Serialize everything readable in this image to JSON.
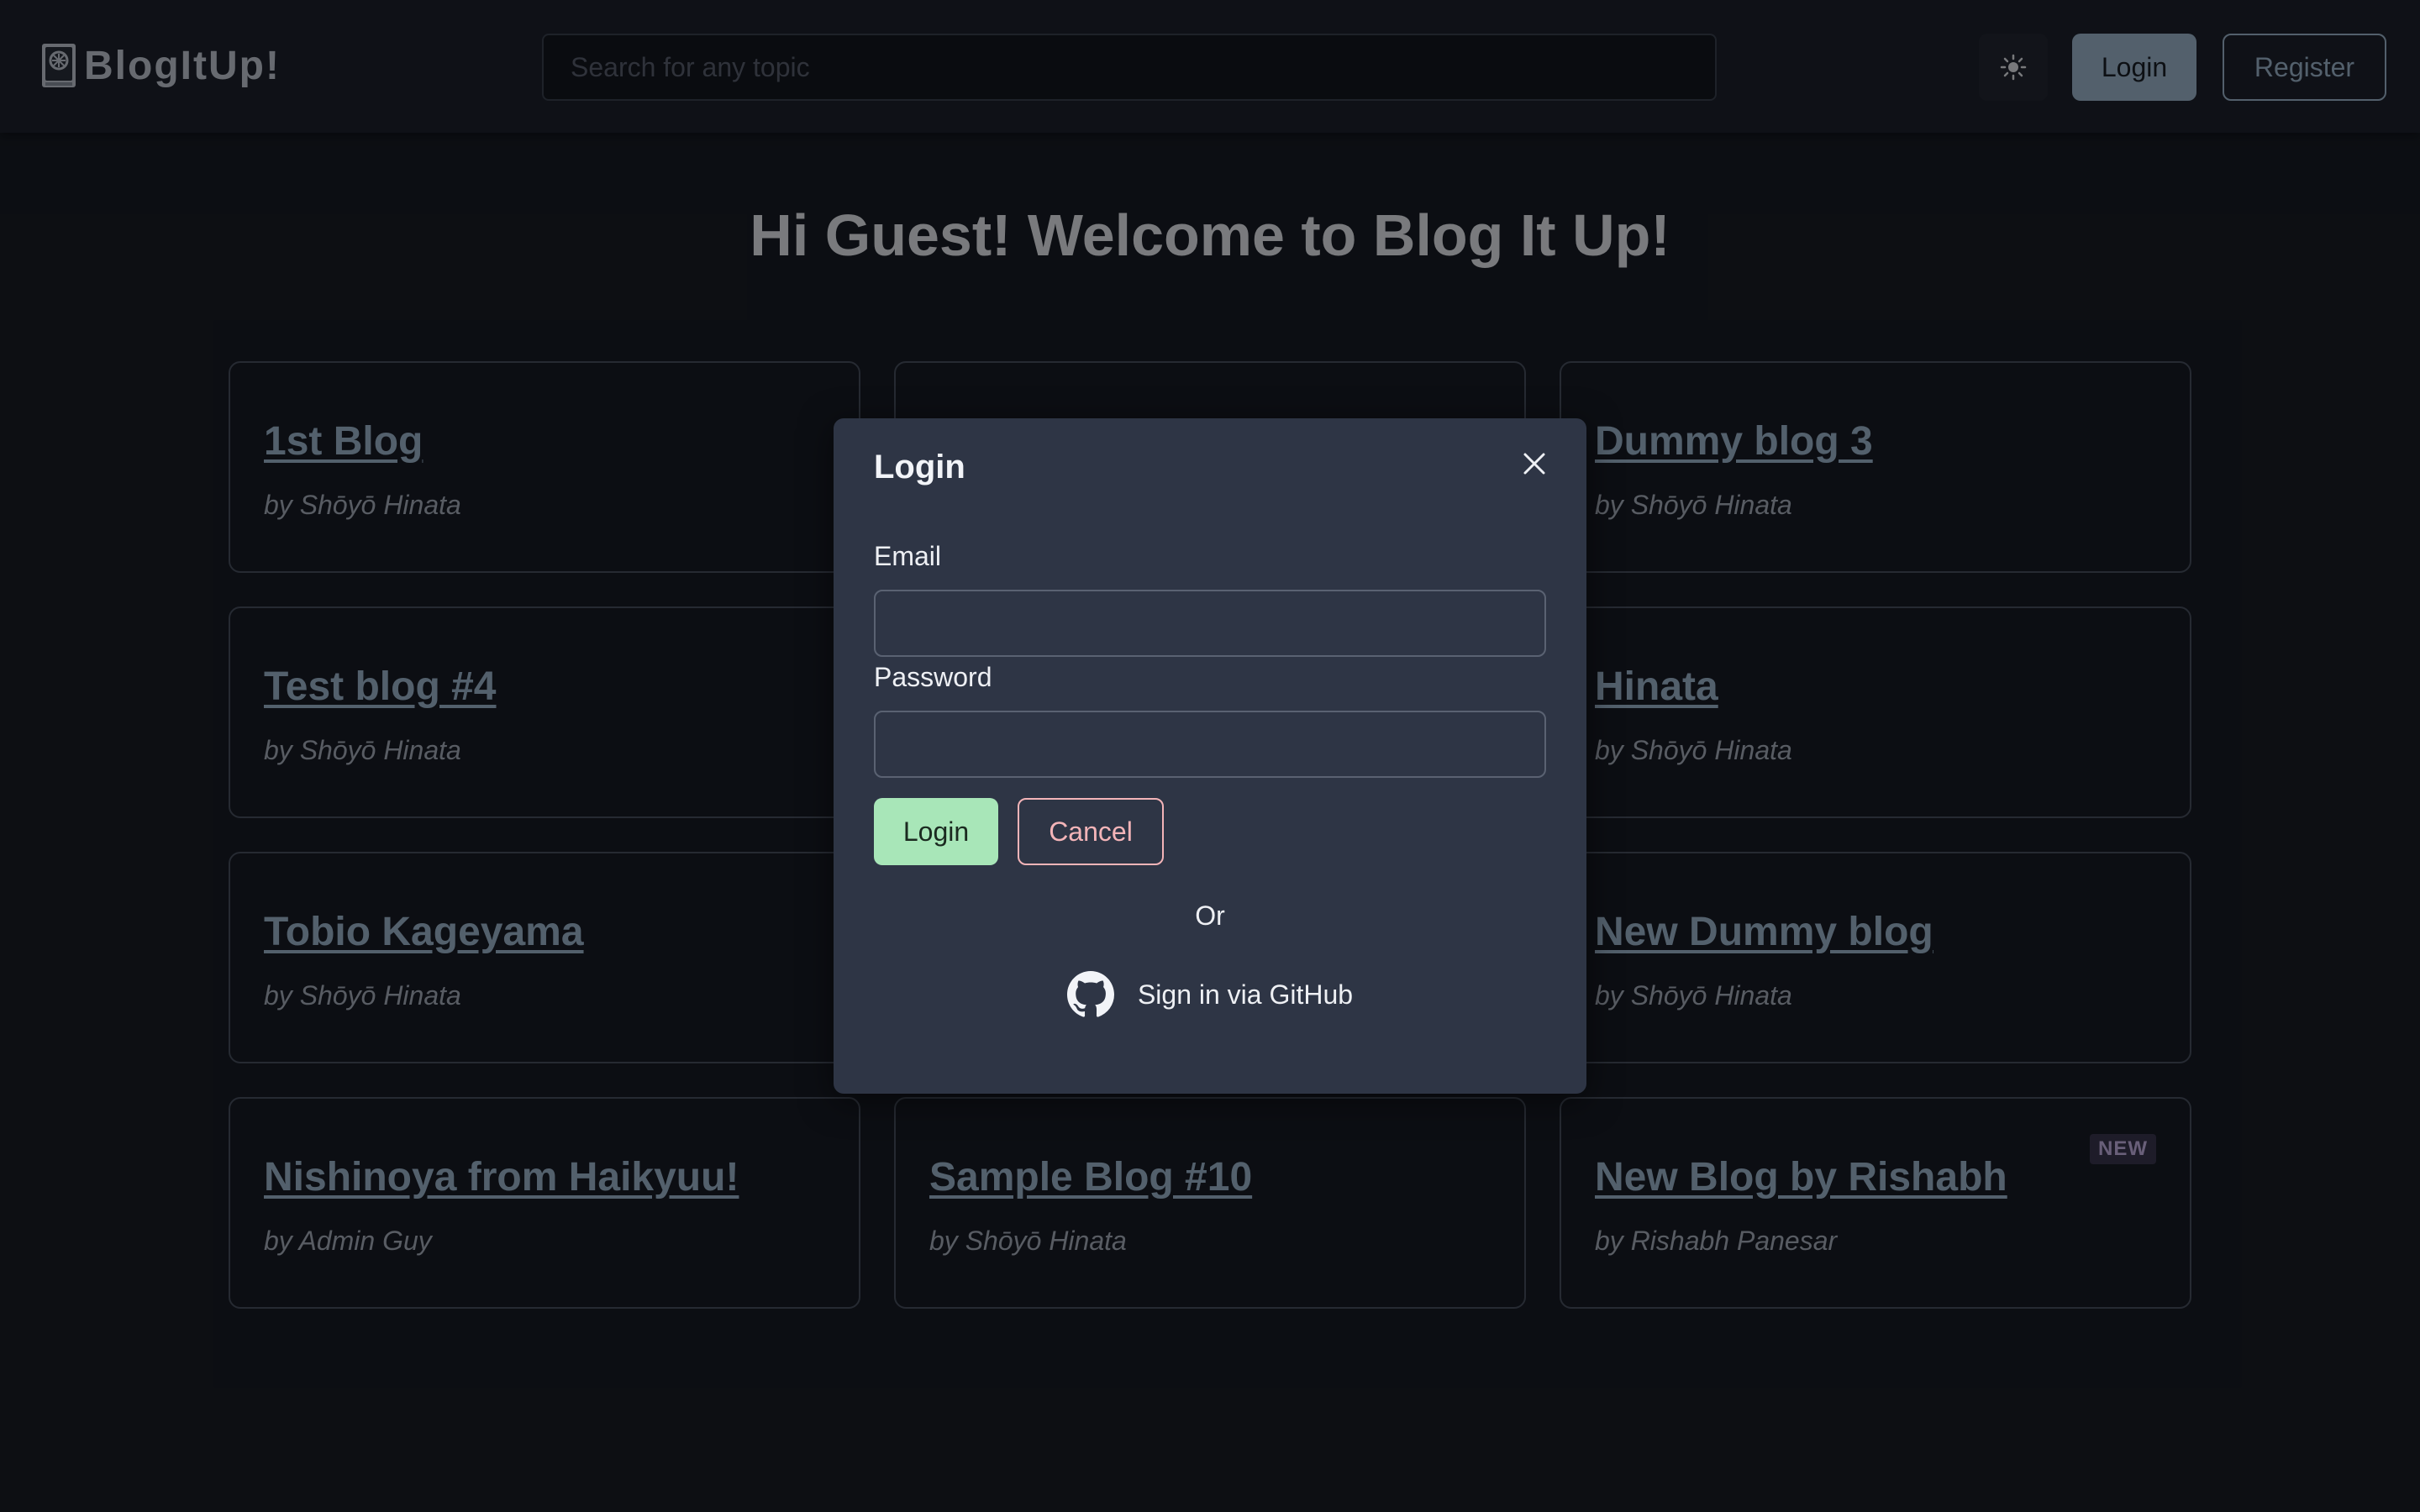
{
  "header": {
    "logo_text": "BlogItUp!",
    "search_placeholder": "Search for any topic",
    "theme_icon": "sun-icon",
    "login_label": "Login",
    "register_label": "Register"
  },
  "main": {
    "welcome": "Hi Guest! Welcome to Blog It Up!",
    "cards": [
      {
        "title": "1st Blog",
        "author": "by Shōyō Hinata"
      },
      {
        "title": "",
        "author": ""
      },
      {
        "title": "Dummy blog 3",
        "author": "by Shōyō Hinata"
      },
      {
        "title": "Test blog #4",
        "author": "by Shōyō Hinata"
      },
      {
        "title": "",
        "author": ""
      },
      {
        "title": "Hinata",
        "author": "by Shōyō Hinata"
      },
      {
        "title": "Tobio Kageyama",
        "author": "by Shōyō Hinata"
      },
      {
        "title": "",
        "author": ""
      },
      {
        "title": "New Dummy blog",
        "author": "by Shōyō Hinata"
      },
      {
        "title": "Nishinoya from Haikyuu!",
        "author": "by Admin Guy"
      },
      {
        "title": "Sample Blog #10",
        "author": "by Shōyō Hinata"
      },
      {
        "title": "New Blog by Rishabh",
        "author": "by Rishabh Panesar",
        "badge": "NEW"
      }
    ]
  },
  "modal": {
    "title": "Login",
    "email_label": "Email",
    "email_value": "",
    "password_label": "Password",
    "password_value": "",
    "login_label": "Login",
    "cancel_label": "Cancel",
    "or_text": "Or",
    "github_label": "Sign in via GitHub"
  },
  "colors": {
    "background": "#181c25",
    "accent": "#9fb8d0",
    "login_green": "#a8e6b8",
    "cancel_pink": "#f3b4b8",
    "modal_bg": "#2e3545"
  }
}
